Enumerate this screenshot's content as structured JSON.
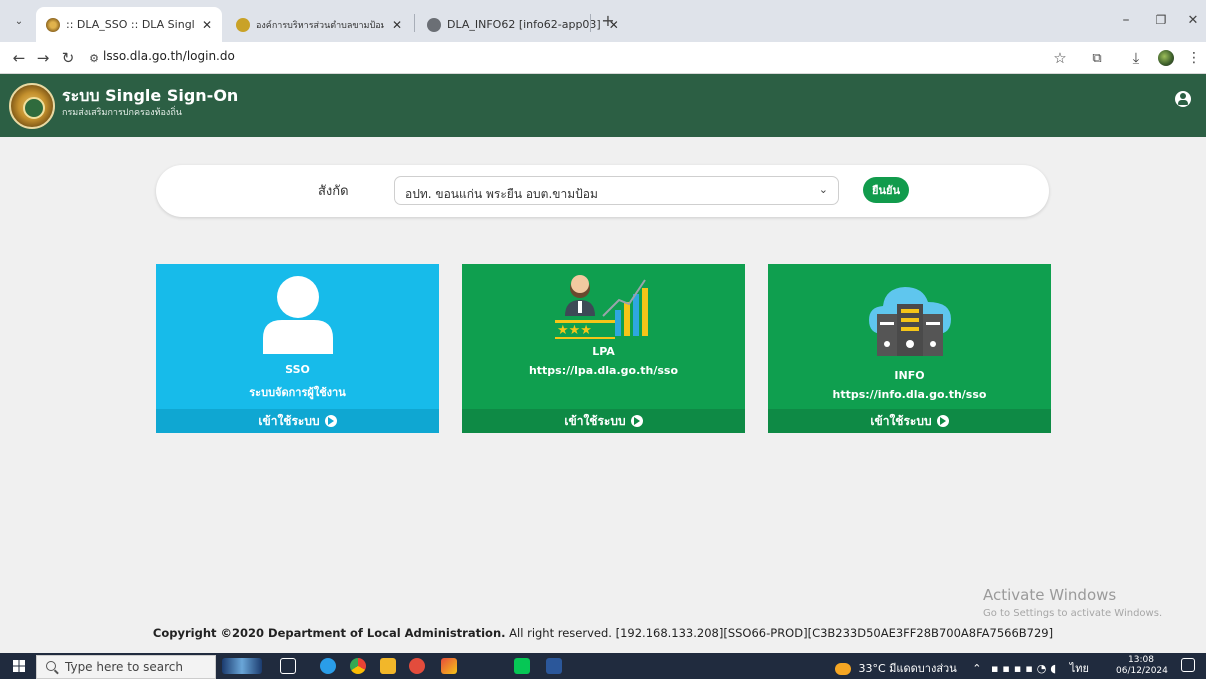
{
  "browser": {
    "tabs": [
      {
        "label": ":: DLA_SSO :: DLA Single Sign-o",
        "active": true
      },
      {
        "label": "องค์การบริหารส่วนตำบลขามป้อม (อ",
        "active": false
      },
      {
        "label": "DLA_INFO62 [info62-app03]",
        "active": false
      }
    ],
    "new_tab": "+",
    "close": "✕",
    "url": "lsso.dla.go.th/login.do"
  },
  "header": {
    "title": "ระบบ Single Sign-On",
    "subtitle": "กรมส่งเสริมการปกครองท้องถิ่น"
  },
  "filter": {
    "label": "สังกัด",
    "selected": "อปท. ขอนแก่น พระยืน อบต.ขามป้อม",
    "confirm_label": "ยืนยัน"
  },
  "cards": [
    {
      "title": "SSO",
      "subtitle": "ระบบจัดการผู้ใช้งาน",
      "action": "เข้าใช้ระบบ",
      "icon": "user-icon"
    },
    {
      "title": "LPA",
      "subtitle": "https://lpa.dla.go.th/sso",
      "action": "เข้าใช้ระบบ",
      "icon": "performance-chart-icon"
    },
    {
      "title": "INFO",
      "subtitle": "https://info.dla.go.th/sso",
      "action": "เข้าใช้ระบบ",
      "icon": "cloud-server-icon"
    }
  ],
  "watermark": {
    "title": "Activate Windows",
    "subtitle": "Go to Settings to activate Windows."
  },
  "footer": {
    "strong": "Copyright ©2020 Department of Local Administration.",
    "text": "All right reserved. [192.168.133.208][SSO66-PROD][C3B233D50AE3FF28B700A8FA7566B729]"
  },
  "taskbar": {
    "search_placeholder": "Type here to search",
    "weather": "33°C  มีแดดบางส่วน",
    "lang": "ไทย",
    "time": "13:08",
    "date": "06/12/2024"
  },
  "colors": {
    "header_green": "#2c5f44",
    "sso_blue": "#17bbea",
    "card_green": "#0f9f4f",
    "confirm_green": "#119b4c"
  }
}
